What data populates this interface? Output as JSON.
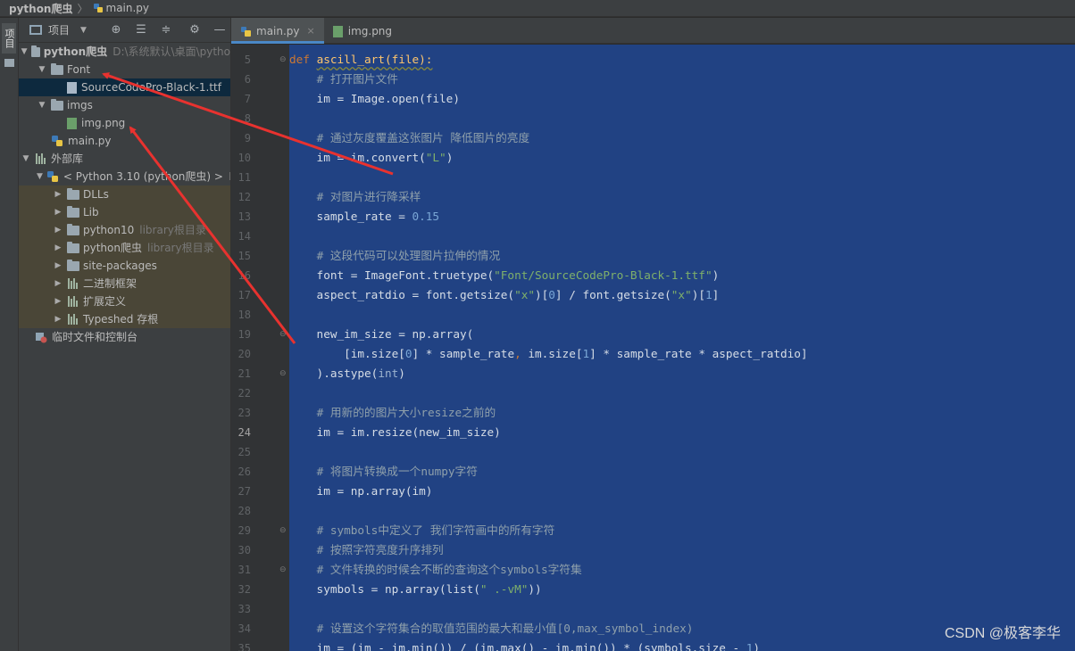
{
  "breadcrumb": {
    "project": "python爬虫",
    "file": "main.py"
  },
  "toolstrip": {
    "project_tab": "项目"
  },
  "project_panel": {
    "title": "项目",
    "tree": [
      {
        "label": "python爬虫",
        "hint": "D:\\系统默认\\桌面\\pytho",
        "depth": 0,
        "arrow": "▼",
        "icon": "folder",
        "bold": true
      },
      {
        "label": "Font",
        "hint": "",
        "depth": 1,
        "arrow": "▼",
        "icon": "folder"
      },
      {
        "label": "SourceCodePro-Black-1.ttf",
        "hint": "",
        "depth": 2,
        "arrow": "",
        "icon": "file",
        "selected": true
      },
      {
        "label": "imgs",
        "hint": "",
        "depth": 1,
        "arrow": "▼",
        "icon": "folder"
      },
      {
        "label": "img.png",
        "hint": "",
        "depth": 2,
        "arrow": "",
        "icon": "img"
      },
      {
        "label": "main.py",
        "hint": "",
        "depth": 1,
        "arrow": "",
        "icon": "py"
      },
      {
        "label": "外部库",
        "hint": "",
        "depth": 0,
        "arrow": "▼",
        "icon": "lib"
      },
      {
        "label": "< Python 3.10 (python爬虫) >",
        "hint": "D",
        "depth": 1,
        "arrow": "▼",
        "icon": "py"
      },
      {
        "label": "DLLs",
        "hint": "",
        "depth": 2,
        "arrow": "▶",
        "icon": "folder",
        "lib": true
      },
      {
        "label": "Lib",
        "hint": "",
        "depth": 2,
        "arrow": "▶",
        "icon": "folder",
        "lib": true
      },
      {
        "label": "python10",
        "hint": "library根目录",
        "depth": 2,
        "arrow": "▶",
        "icon": "folder",
        "lib": true
      },
      {
        "label": "python爬虫",
        "hint": "library根目录",
        "depth": 2,
        "arrow": "▶",
        "icon": "folder",
        "lib": true
      },
      {
        "label": "site-packages",
        "hint": "",
        "depth": 2,
        "arrow": "▶",
        "icon": "folder",
        "lib": true
      },
      {
        "label": "二进制框架",
        "hint": "",
        "depth": 2,
        "arrow": "▶",
        "icon": "lib",
        "lib": true
      },
      {
        "label": "扩展定义",
        "hint": "",
        "depth": 2,
        "arrow": "▶",
        "icon": "lib",
        "lib": true
      },
      {
        "label": "Typeshed 存根",
        "hint": "",
        "depth": 2,
        "arrow": "▶",
        "icon": "lib",
        "lib": true
      },
      {
        "label": "临时文件和控制台",
        "hint": "",
        "depth": 0,
        "arrow": "",
        "icon": "scratch"
      }
    ]
  },
  "tabs": [
    {
      "label": "main.py",
      "active": true,
      "close": "×"
    },
    {
      "label": "img.png",
      "active": false,
      "close": ""
    }
  ],
  "current_line": 24,
  "code_lines": [
    {
      "n": 5,
      "html": "<span class=\"kw\">def</span> <span class=\"fn\">ascill_art(file):</span>",
      "fold": true
    },
    {
      "n": 6,
      "html": "    <span class=\"cm\"># 打开图片文件</span>"
    },
    {
      "n": 7,
      "html": "    im = Image.open(file)"
    },
    {
      "n": 8,
      "html": ""
    },
    {
      "n": 9,
      "html": "    <span class=\"cm\"># 通过灰度覆盖这张图片 降低图片的亮度</span>"
    },
    {
      "n": 10,
      "html": "    im = im.convert(<span class=\"str\">\"L\"</span>)"
    },
    {
      "n": 11,
      "html": ""
    },
    {
      "n": 12,
      "html": "    <span class=\"cm\"># 对图片进行降采样</span>"
    },
    {
      "n": 13,
      "html": "    sample_rate = <span class=\"num\">0.15</span>"
    },
    {
      "n": 14,
      "html": ""
    },
    {
      "n": 15,
      "html": "    <span class=\"cm\"># 这段代码可以处理图片拉伸的情况</span>"
    },
    {
      "n": 16,
      "html": "    font = ImageFont.truetype(<span class=\"str\">\"Font/SourceCodePro-Black-1.ttf\"</span>)"
    },
    {
      "n": 17,
      "html": "    aspect_ratdio = font.getsize(<span class=\"str\">\"x\"</span>)[<span class=\"num\">0</span>] / font.getsize(<span class=\"str\">\"x\"</span>)[<span class=\"num\">1</span>]"
    },
    {
      "n": 18,
      "html": ""
    },
    {
      "n": 19,
      "html": "    new_im_size = np.array(",
      "fold": true
    },
    {
      "n": 20,
      "html": "        [im.size[<span class=\"num\">0</span>] * sample_rate<span class=\"kw\">,</span> im.size[<span class=\"num\">1</span>] * sample_rate * aspect_ratdio]"
    },
    {
      "n": 21,
      "html": "    ).astype(<span class=\"bi\">int</span>)",
      "fold": true
    },
    {
      "n": 22,
      "html": ""
    },
    {
      "n": 23,
      "html": "    <span class=\"cm\"># 用新的的图片大小resize之前的</span>"
    },
    {
      "n": 24,
      "html": "    im = im.resize(new_im_size)"
    },
    {
      "n": 25,
      "html": ""
    },
    {
      "n": 26,
      "html": "    <span class=\"cm\"># 将图片转换成一个numpy字符</span>"
    },
    {
      "n": 27,
      "html": "    im = np.array(im)"
    },
    {
      "n": 28,
      "html": ""
    },
    {
      "n": 29,
      "html": "    <span class=\"cm\"># symbols中定义了 我们字符画中的所有字符</span>",
      "fold": true
    },
    {
      "n": 30,
      "html": "    <span class=\"cm\"># 按照字符亮度升序排列</span>"
    },
    {
      "n": 31,
      "html": "    <span class=\"cm\"># 文件转换的时候会不断的查询这个symbols字符集</span>",
      "fold": true
    },
    {
      "n": 32,
      "html": "    symbols = np.array(list(<span class=\"str\">\" .-vM\"</span>))"
    },
    {
      "n": 33,
      "html": ""
    },
    {
      "n": 34,
      "html": "    <span class=\"cm\"># 设置这个字符集合的取值范围的最大和最小值[0,max_symbol_index)</span>"
    },
    {
      "n": 35,
      "html": "    im = (im - im.min()) / (im.max() - im.min()) * (symbols.size - <span class=\"num\">1</span>)"
    }
  ],
  "watermark": "CSDN @极客李华",
  "colors": {
    "accent": "#4a88c7",
    "selection": "#214283",
    "arrow": "#e8322f"
  }
}
